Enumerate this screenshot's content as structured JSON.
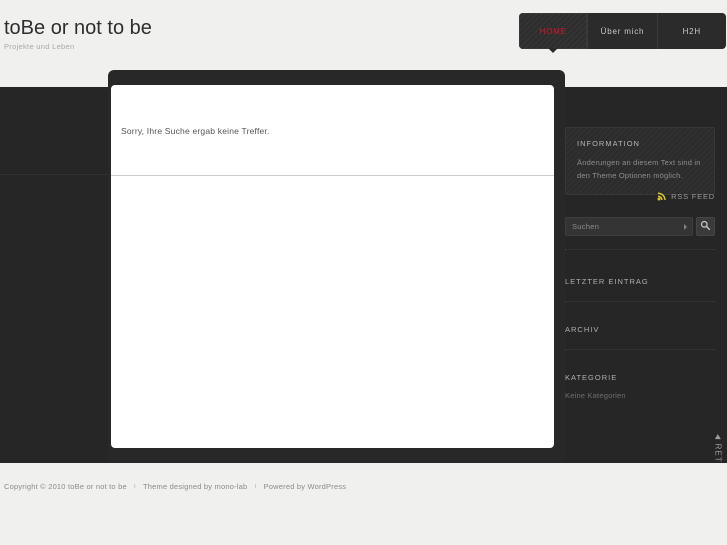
{
  "header": {
    "site_title": "toBe or not to be",
    "tagline": "Projekte und Leben"
  },
  "nav": {
    "items": [
      {
        "label": "HOME",
        "active": true
      },
      {
        "label": "Über mich",
        "active": false
      },
      {
        "label": "H2H",
        "active": false
      }
    ]
  },
  "content": {
    "message": "Sorry, Ihre Suche ergab keine Treffer."
  },
  "sidebar": {
    "info": {
      "title": "INFORMATION",
      "text": "Änderungen an diesem Text sind in den Theme Optionen möglich."
    },
    "rss": {
      "label": "RSS FEED",
      "icon": "rss-icon",
      "color": "#d8c32e"
    },
    "search": {
      "placeholder": "Suchen",
      "value": "",
      "button_icon": "magnifier-icon"
    },
    "widgets": [
      {
        "title": "LETZTER EINTRAG",
        "text": ""
      },
      {
        "title": "ARCHIV",
        "text": ""
      },
      {
        "title": "KATEGORIE",
        "text": "Keine Kategorien"
      }
    ]
  },
  "return_top": {
    "label": "RETURN TOP"
  },
  "footer": {
    "copyright": "Copyright ©  2010  toBe or not to be",
    "separator": "ı",
    "theme_credit": "Theme designed by mono-lab",
    "powered_by": "Powered by WordPress"
  },
  "colors": {
    "accent_red": "#d2172a",
    "dark_bg": "#262626",
    "page_bg": "#f0f0ef",
    "rss_gold": "#d8c32e"
  }
}
